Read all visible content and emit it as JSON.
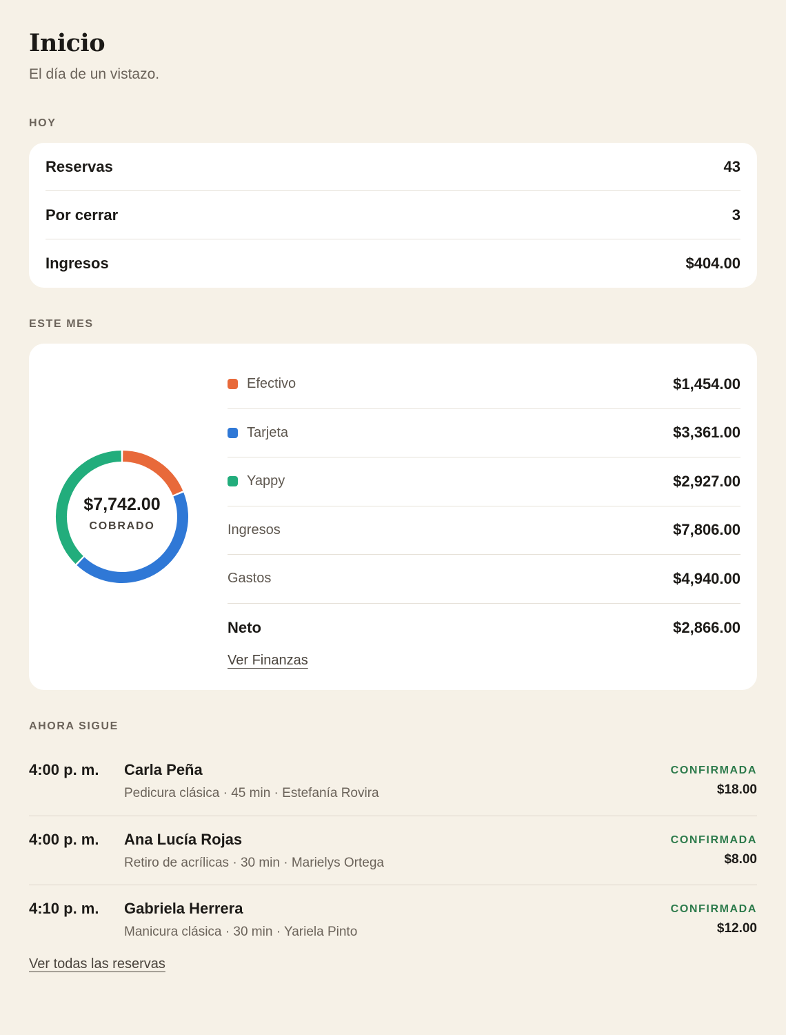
{
  "header": {
    "title": "Inicio",
    "subtitle": "El día de un vistazo."
  },
  "today": {
    "label": "HOY",
    "rows": [
      {
        "label": "Reservas",
        "value": "43"
      },
      {
        "label": "Por cerrar",
        "value": "3"
      },
      {
        "label": "Ingresos",
        "value": "$404.00"
      }
    ]
  },
  "month": {
    "label": "ESTE MES",
    "collected_total": "$7,742.00",
    "collected_caption": "COBRADO",
    "payment_methods": [
      {
        "label": "Efectivo",
        "amount": "$1,454.00",
        "value": 1454,
        "color": "#e8693a"
      },
      {
        "label": "Tarjeta",
        "amount": "$3,361.00",
        "value": 3361,
        "color": "#2f78d6"
      },
      {
        "label": "Yappy",
        "amount": "$2,927.00",
        "value": 2927,
        "color": "#22ad7c"
      }
    ],
    "summary": [
      {
        "label": "Ingresos",
        "amount": "$7,806.00"
      },
      {
        "label": "Gastos",
        "amount": "$4,940.00"
      },
      {
        "label": "Neto",
        "amount": "$2,866.00"
      }
    ],
    "finance_link": "Ver Finanzas"
  },
  "upcoming": {
    "label": "AHORA SIGUE",
    "appointments": [
      {
        "time": "4:00 p. m.",
        "client": "Carla Peña",
        "detail": "Pedicura clásica · 45 min · Estefanía Rovira",
        "status": "CONFIRMADA",
        "price": "$18.00"
      },
      {
        "time": "4:00 p. m.",
        "client": "Ana Lucía Rojas",
        "detail": "Retiro de acrílicas · 30 min · Marielys Ortega",
        "status": "CONFIRMADA",
        "price": "$8.00"
      },
      {
        "time": "4:10 p. m.",
        "client": "Gabriela Herrera",
        "detail": "Manicura clásica · 30 min · Yariela Pinto",
        "status": "CONFIRMADA",
        "price": "$12.00"
      }
    ],
    "all_link": "Ver todas las reservas"
  }
}
